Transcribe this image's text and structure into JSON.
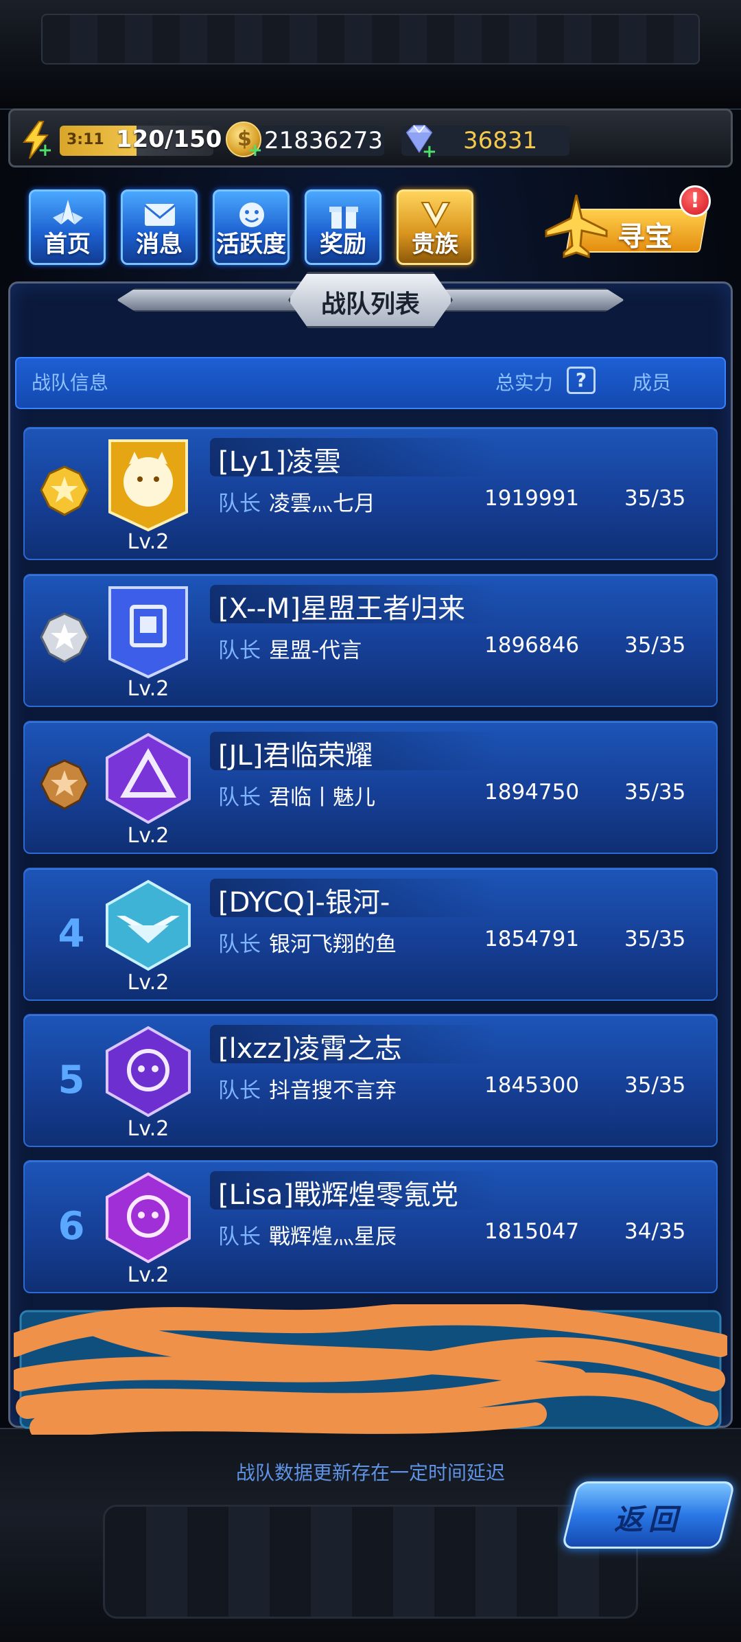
{
  "resources": {
    "energy_timer": "3:11",
    "energy": "120/150",
    "coins": "21836273",
    "gems": "36831"
  },
  "nav": [
    {
      "label": "首页",
      "icon": "home-wing-icon"
    },
    {
      "label": "消息",
      "icon": "message-envelope-icon"
    },
    {
      "label": "活跃度",
      "icon": "activity-smile-icon"
    },
    {
      "label": "奖励",
      "icon": "gift-box-icon"
    },
    {
      "label": "贵族",
      "icon": "noble-v-icon"
    }
  ],
  "treasure": {
    "label": "寻宝",
    "badge": "!"
  },
  "panel": {
    "title": "战队列表",
    "header": {
      "info": "战队信息",
      "power": "总实力",
      "help": "?",
      "members": "成员"
    }
  },
  "teams": [
    {
      "rank": "1",
      "name": "[Ly1]凌雲",
      "captain_label": "队长",
      "captain": "凌雲灬七月",
      "power": "1919991",
      "members": "35/35",
      "level": "Lv.2",
      "medal": "gold"
    },
    {
      "rank": "2",
      "name": "[X--M]星盟王者归来",
      "captain_label": "队长",
      "captain": "星盟-代言",
      "power": "1896846",
      "members": "35/35",
      "level": "Lv.2",
      "medal": "silver"
    },
    {
      "rank": "3",
      "name": "[JL]君临荣耀",
      "captain_label": "队长",
      "captain": "君临丨魅儿",
      "power": "1894750",
      "members": "35/35",
      "level": "Lv.2",
      "medal": "bronze"
    },
    {
      "rank": "4",
      "name": "[DYCQ]-银河-",
      "captain_label": "队长",
      "captain": "银河飞翔的鱼",
      "power": "1854791",
      "members": "35/35",
      "level": "Lv.2",
      "medal": ""
    },
    {
      "rank": "5",
      "name": "[lxzz]凌霄之志",
      "captain_label": "队长",
      "captain": "抖音搜不言弃",
      "power": "1845300",
      "members": "35/35",
      "level": "Lv.2",
      "medal": ""
    },
    {
      "rank": "6",
      "name": "[Lisa]戰辉煌零氪党",
      "captain_label": "队长",
      "captain": "戰辉煌灬星辰",
      "power": "1815047",
      "members": "34/35",
      "level": "Lv.2",
      "medal": ""
    }
  ],
  "footer": {
    "notice": "战队数据更新存在一定时间延迟",
    "back": "返回"
  },
  "colors": {
    "accent_blue": "#1c55b8",
    "gold": "#f2c94c",
    "redaction": "#f0914a"
  }
}
